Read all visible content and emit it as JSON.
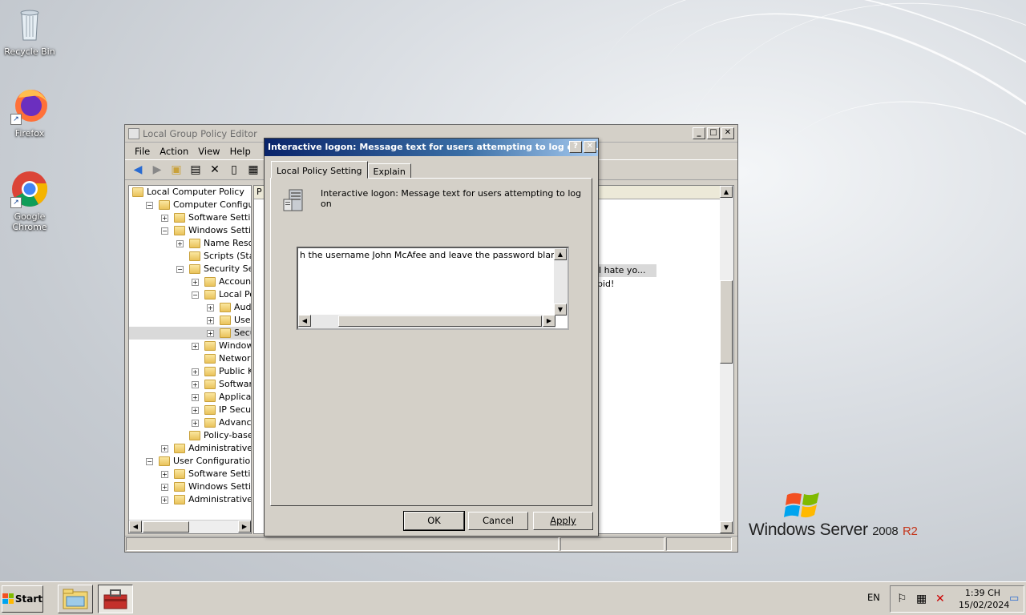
{
  "desktop": {
    "icons": [
      {
        "label": "Recycle Bin"
      },
      {
        "label": "Firefox"
      },
      {
        "label": "Google Chrome"
      }
    ],
    "brand": {
      "text": "Windows Server",
      "version": "2008",
      "suffix": "R2"
    }
  },
  "gpedit": {
    "title": "Local Group Policy Editor",
    "menu": [
      "File",
      "Action",
      "View",
      "Help"
    ],
    "tree": [
      {
        "label": "Local Computer Policy",
        "indent": 0,
        "pm": ""
      },
      {
        "label": "Computer Configuratio",
        "indent": 1,
        "pm": "−"
      },
      {
        "label": "Software Settings",
        "indent": 2,
        "pm": "+"
      },
      {
        "label": "Windows Settings",
        "indent": 2,
        "pm": "−"
      },
      {
        "label": "Name Resolutio",
        "indent": 3,
        "pm": "+"
      },
      {
        "label": "Scripts (Startup",
        "indent": 3,
        "pm": ""
      },
      {
        "label": "Security Settin",
        "indent": 3,
        "pm": "−"
      },
      {
        "label": "Account Po",
        "indent": 4,
        "pm": "+"
      },
      {
        "label": "Local Polici",
        "indent": 4,
        "pm": "−"
      },
      {
        "label": "Audit P",
        "indent": 5,
        "pm": "+"
      },
      {
        "label": "User Ri",
        "indent": 5,
        "pm": "+"
      },
      {
        "label": "Securit",
        "indent": 5,
        "pm": "+",
        "selected": true
      },
      {
        "label": "Windows F",
        "indent": 4,
        "pm": "+"
      },
      {
        "label": "Network Lis",
        "indent": 4,
        "pm": ""
      },
      {
        "label": "Public Key I",
        "indent": 4,
        "pm": "+"
      },
      {
        "label": "Software R",
        "indent": 4,
        "pm": "+"
      },
      {
        "label": "Application",
        "indent": 4,
        "pm": "+"
      },
      {
        "label": "IP Security",
        "indent": 4,
        "pm": "+"
      },
      {
        "label": "Advanced ,",
        "indent": 4,
        "pm": "+"
      },
      {
        "label": "Policy-based Q",
        "indent": 3,
        "pm": ""
      },
      {
        "label": "Administrative Tem",
        "indent": 2,
        "pm": "+"
      },
      {
        "label": "User Configuration",
        "indent": 1,
        "pm": "−"
      },
      {
        "label": "Software Settings",
        "indent": 2,
        "pm": "+"
      },
      {
        "label": "Windows Settings",
        "indent": 2,
        "pm": "+"
      },
      {
        "label": "Administrative Tem",
        "indent": 2,
        "pm": "+"
      }
    ],
    "list_col_first": "P",
    "list_visible": {
      "row1": "! I hate yo...",
      "row2": "pid!"
    }
  },
  "dialog": {
    "title": "Interactive logon: Message text for users attempting to log on Pr...",
    "tabs": [
      "Local Policy Setting",
      "Explain"
    ],
    "policy_name": "Interactive logon: Message text for users attempting to log on",
    "text_value": "h the username John McAfee and leave the password blank. Have",
    "buttons": {
      "ok": "OK",
      "cancel": "Cancel",
      "apply": "Apply"
    }
  },
  "taskbar": {
    "start": "Start",
    "lang": "EN",
    "time": "1:39 CH",
    "date": "15/02/2024"
  }
}
